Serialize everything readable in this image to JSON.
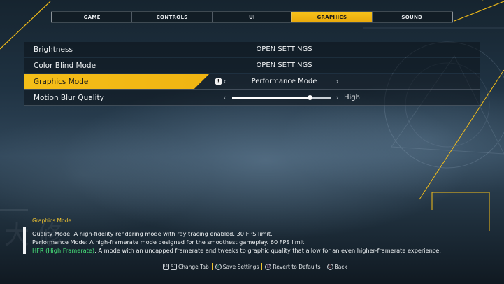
{
  "tabs": [
    {
      "label": "GAME",
      "active": false
    },
    {
      "label": "CONTROLS",
      "active": false
    },
    {
      "label": "UI",
      "active": false
    },
    {
      "label": "GRAPHICS",
      "active": true
    },
    {
      "label": "SOUND",
      "active": false
    }
  ],
  "settings": {
    "brightness": {
      "label": "Brightness",
      "value": "OPEN SETTINGS"
    },
    "color_blind": {
      "label": "Color Blind Mode",
      "value": "OPEN SETTINGS"
    },
    "graphics_mode": {
      "label": "Graphics Mode",
      "value": "Performance Mode",
      "warning_icon": "!"
    },
    "motion_blur": {
      "label": "Motion Blur Quality",
      "value": "High",
      "slider_fraction": 0.78
    }
  },
  "description": {
    "title": "Graphics Mode",
    "quality": "Quality Mode: A high-fidelity rendering mode with ray tracing enabled. 30 FPS limit.",
    "performance": "Performance Mode: A high-framerate mode designed for the smoothest gameplay. 60 FPS limit.",
    "hfr_name": "HFR (High Framerate)",
    "hfr_text": ": A mode with an uncapped framerate and tweaks to graphic quality that allow for an even higher-framerate experience."
  },
  "footer": {
    "change_tab": "Change Tab",
    "save": "Save Settings",
    "revert": "Revert to Defaults",
    "back": "Back",
    "l1": "L1",
    "r1": "R1",
    "triangle": "△",
    "square": "□",
    "circle": "○"
  },
  "colors": {
    "accent": "#f5be18",
    "hfr": "#48e47a"
  },
  "chevron_left": "‹",
  "chevron_right": "›"
}
